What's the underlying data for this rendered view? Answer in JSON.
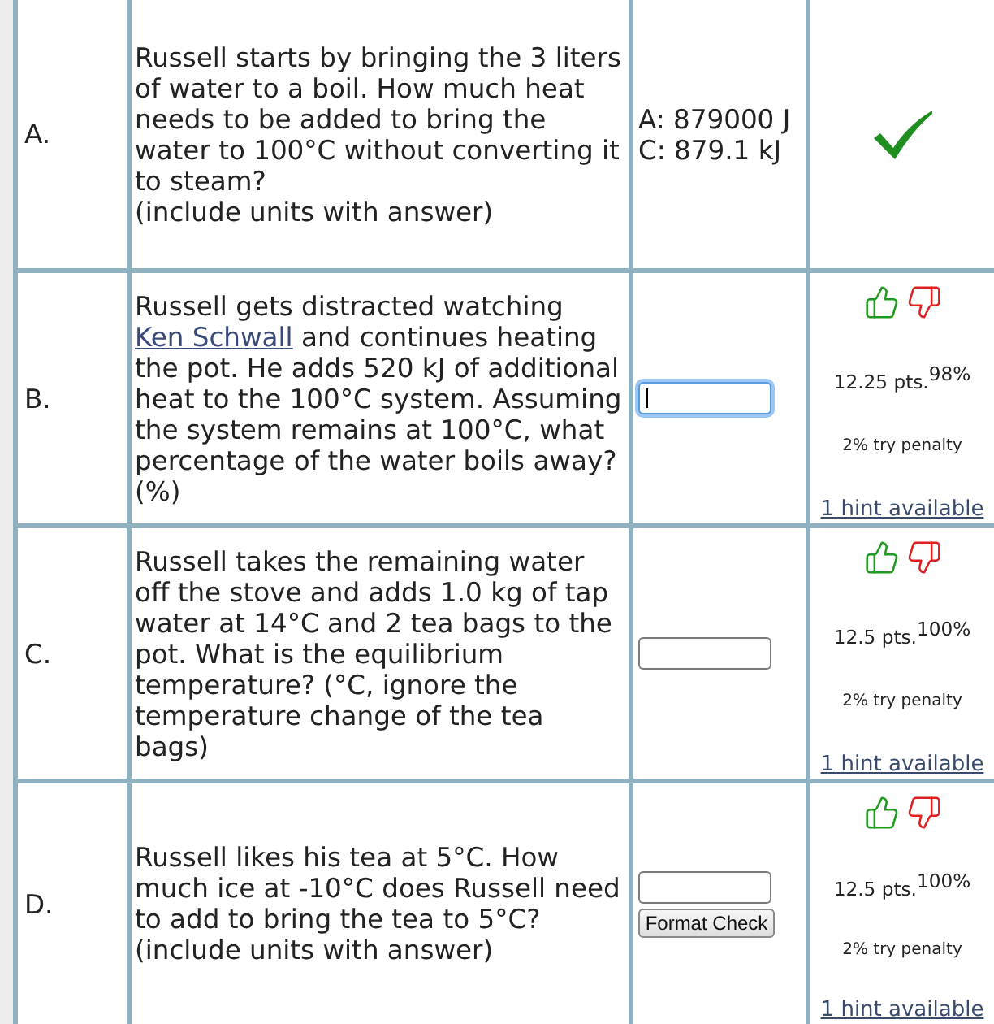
{
  "rows": [
    {
      "label": "A.",
      "kind": "graded",
      "question": [
        {
          "kind": "text",
          "text": "Russell starts by bringing the 3 liters of water to a boil. How much heat needs to be added to bring the water to 100°C without converting it to steam?"
        }
      ],
      "note": "(include units with answer)",
      "answers": [
        "A: 879000 J",
        "C: 879.1 kJ"
      ],
      "correct": true
    },
    {
      "label": "B.",
      "kind": "open",
      "question": [
        {
          "kind": "text",
          "text": "Russell gets distracted watching"
        },
        {
          "kind": "link",
          "text": "Ken Schwall"
        },
        {
          "kind": "text",
          "text": "and continues heating the pot. He adds 520 kJ of additional heat to the 100°C system. Assuming the system remains at 100°C, what percentage of the water boils away?"
        }
      ],
      "note": "(%)",
      "field": {
        "focused": true
      },
      "points": "12.25 pts.",
      "percent": "98%",
      "penalty": "2% try penalty",
      "hint": "1 hint available"
    },
    {
      "label": "C.",
      "kind": "open",
      "question": [
        {
          "kind": "text",
          "text": "Russell takes the remaining water off the stove and adds 1.0 kg of tap water at 14°C and 2 tea bags to the pot. What is the equilibrium temperature? (°C, ignore the temperature change of the tea bags)"
        }
      ],
      "field": {
        "focused": false
      },
      "points": "12.5 pts.",
      "percent": "100%",
      "penalty": "2% try penalty",
      "hint": "1 hint available"
    },
    {
      "label": "D.",
      "kind": "open",
      "question": [
        {
          "kind": "text",
          "text": "Russell likes his tea at 5°C. How much ice at -10°C does Russell need to add to bring the tea to 5°C?"
        }
      ],
      "note": "(include units with answer)",
      "field": {
        "focused": false
      },
      "button": "Format Check",
      "points": "12.5 pts.",
      "percent": "100%",
      "penalty": "2% try penalty",
      "hint": "1 hint available"
    }
  ]
}
